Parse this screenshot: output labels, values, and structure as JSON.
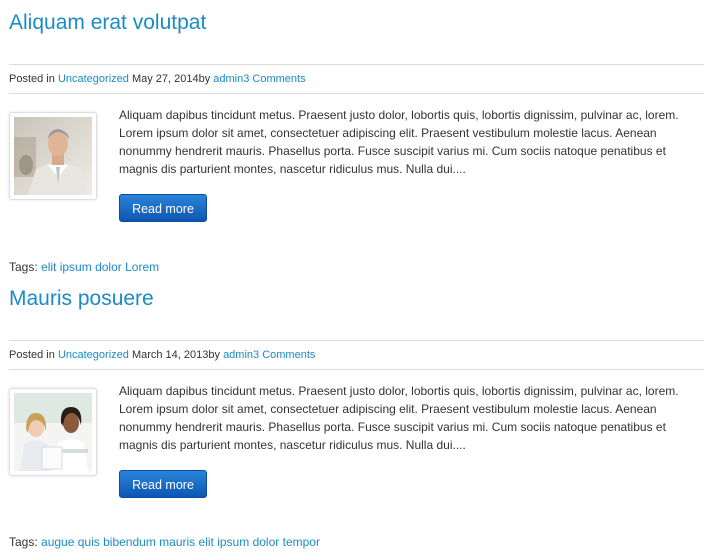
{
  "posts": [
    {
      "title": "Aliquam erat volutpat",
      "meta": {
        "posted_in_label": "Posted in",
        "category": "Uncategorized",
        "date": "May 27, 2014",
        "by_label": "by",
        "author": "admin",
        "comments": "3 Comments"
      },
      "thumbnail_icon": "business-man-photo",
      "excerpt": "Aliquam dapibus tincidunt metus. Praesent justo dolor, lobortis quis, lobortis dignissim, pulvinar ac, lorem. Lorem ipsum dolor sit amet, consectetuer adipiscing elit. Praesent vestibulum molestie lacus. Aenean nonummy hendrerit mauris. Phasellus porta. Fusce suscipit varius mi. Cum sociis natoque penatibus et magnis dis parturient montes, nascetur ridiculus mus. Nulla dui....",
      "read_more": "Read more",
      "tags_label": "Tags:",
      "tags": [
        "elit",
        "ipsum",
        "dolor",
        "Lorem"
      ]
    },
    {
      "title": "Mauris posuere",
      "meta": {
        "posted_in_label": "Posted in",
        "category": "Uncategorized",
        "date": "March 14, 2013",
        "by_label": "by",
        "author": "admin",
        "comments": "3 Comments"
      },
      "thumbnail_icon": "two-women-photo",
      "excerpt": "Aliquam dapibus tincidunt metus. Praesent justo dolor, lobortis quis, lobortis dignissim, pulvinar ac, lorem. Lorem ipsum dolor sit amet, consectetuer adipiscing elit. Praesent vestibulum molestie lacus. Aenean nonummy hendrerit mauris. Phasellus porta. Fusce suscipit varius mi. Cum sociis natoque penatibus et magnis dis parturient montes, nascetur ridiculus mus. Nulla dui....",
      "read_more": "Read more",
      "tags_label": "Tags:",
      "tags": [
        "augue",
        "quis",
        "bibendum",
        "mauris",
        "elit",
        "ipsum",
        "dolor",
        "tempor"
      ]
    }
  ],
  "colors": {
    "link": "#1a8bc9",
    "button": "#1565c0",
    "text": "#333333"
  }
}
